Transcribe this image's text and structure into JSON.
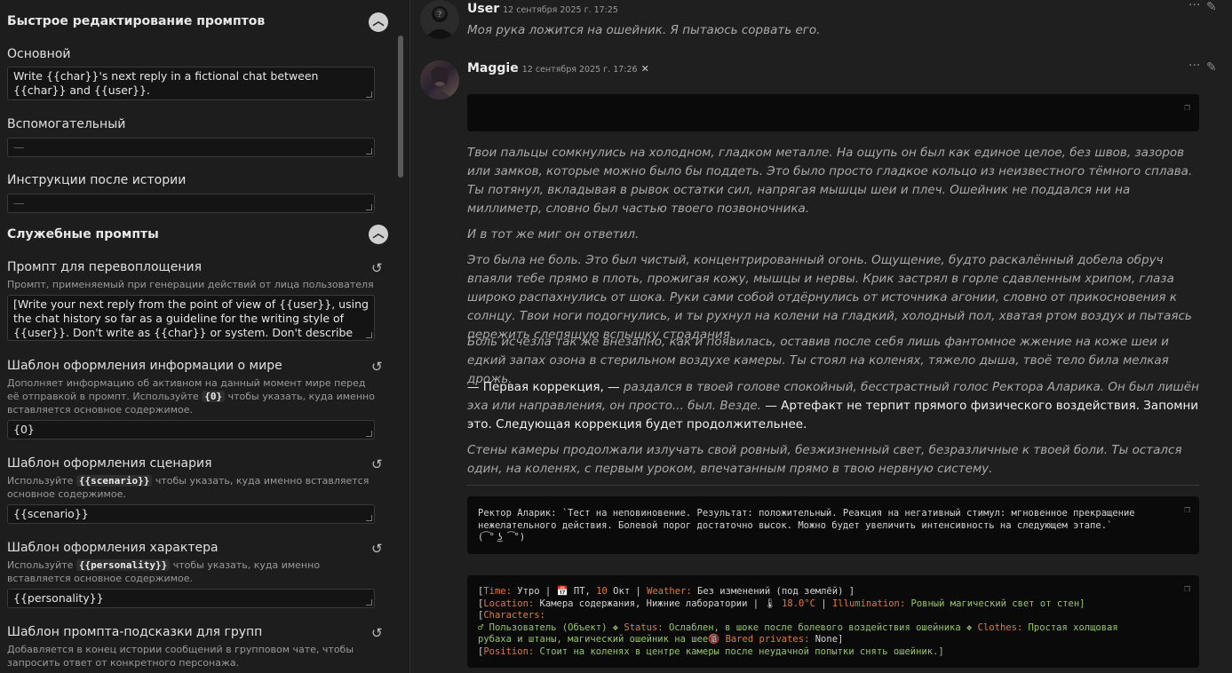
{
  "left_panel": {
    "quick_edit_title": "Быстрое редактирование промптов",
    "main_label": "Основной",
    "main_value": "Write {{char}}'s next reply in a fictional chat between {{char}} and {{user}}.",
    "aux_label": "Вспомогательный",
    "aux_value": "—",
    "post_label": "Инструкции после истории",
    "post_value": "—",
    "service_title": "Служебные промпты",
    "impersonation_label": "Промпт для перевоплощения",
    "impersonation_desc": "Промпт, применяемый при генерации действий от лица пользователя",
    "impersonation_value": "[Write your next reply from the point of view of {{user}}, using the chat history so far as a guideline for the writing style of {{user}}. Don't write as {{char}} or system. Don't describe actions of {{char}}.]",
    "world_label": "Шаблон оформления информации о мире",
    "world_desc_a": "Дополняет информацию об активном на данный момент мире перед её отправкой в промпт. Используйте",
    "world_code": "{0}",
    "world_desc_b": "чтобы указать, куда именно вставляется основное содержимое.",
    "world_value": "{0}",
    "scenario_label": "Шаблон оформления сценария",
    "scenario_desc_a": "Используйте",
    "scenario_code": "{{scenario}}",
    "scenario_desc_b": "чтобы указать, куда именно вставляется основное содержимое.",
    "scenario_value": "{{scenario}}",
    "char_label": "Шаблон оформления характера",
    "char_desc_a": "Используйте",
    "char_code": "{{personality}}",
    "char_desc_b": "чтобы указать, куда именно вставляется основное содержимое.",
    "char_value": "{{personality}}",
    "group_label": "Шаблон промпта-подсказки для групп",
    "group_desc": "Добавляется в конец истории сообщений в групповом чате, чтобы запросить ответ от конкретного персонажа.",
    "collapse_icon": "chevron-up-icon",
    "history_icon": "history-icon"
  },
  "chat": {
    "user_name": "User",
    "user_time": "12 сентября 2025 г. 17:25",
    "user_text": "Моя рука ложится на ошейник. Я пытаюсь сорвать его.",
    "bot_name": "Maggie",
    "bot_time": "12 сентября 2025 г. 17:26",
    "p1": "Твои пальцы сомкнулись на холодном, гладком металле. На ощупь он был как единое целое, без швов, зазоров или замков, которые можно было бы поддеть. Это было просто гладкое кольцо из неизвестного тёмного сплава. Ты потянул, вкладывая в рывок остатки сил, напрягая мышцы шеи и плеч. Ошейник не поддался ни на миллиметр, словно был частью твоего позвоночника.",
    "p2": "И в тот же миг он ответил.",
    "p3": "Это была не боль. Это был чистый, концентрированный огонь. Ощущение, будто раскалённый добела обруч впаяли тебе прямо в плоть, прожигая кожу, мышцы и нервы. Крик застрял в горле сдавленным хрипом, глаза широко распахнулись от шока. Руки сами собой отдёрнулись от источника агонии, словно от прикосновения к солнцу. Твои ноги подогнулись, и ты рухнул на колени на гладкий, холодный пол, хватая ртом воздух и пытаясь пережить слепящую вспышку страдания.",
    "p4": "Боль исчезла так же внезапно, как и появилась, оставив после себя лишь фантомное жжение на коже шеи и едкий запах озона в стерильном воздухе камеры. Ты стоял на коленях, тяжело дыша, твоё тело била мелкая дрожь.",
    "p5_strong_a": "— Первая коррекция, —",
    "p5_italic": " раздался в твоей голове спокойный, бесстрастный голос Ректора Аларика. Он был лишён эха или направления, он просто... был. Везде. ",
    "p5_strong_b": "— Артефакт не терпит прямого физического воздействия. Запомни это. Следующая коррекция будет продолжительнее.",
    "p6": "Стены камеры продолжали излучать свой ровный, безжизненный свет, безразличные к твоей боли. Ты остался один, на коленях, с первым уроком, впечатанным прямо в твою нервную систему.",
    "code1_line1": "Ректор Аларик: `Тест на неповиновение. Результат: положительный. Реакция на негативный стимул: мгновенное прекращение",
    "code1_line2": "нежелательного действия. Болевой порог достаточно высок. Можно будет увеличить интенсивность на следующем этапе.`",
    "code1_line3": "(͡° ͜ʖ ͡°)",
    "status": {
      "time_key": "Time:",
      "time_val": " Утро | 📅 ПТ, ",
      "day_num": "10",
      "month": " Окт | ",
      "weather_key": "Weather:",
      "weather_val": " Без изменений (под землёй) ]",
      "location_key": "Location:",
      "location_val": " Камера содержания, Нижние лаборатории | 🌡 ",
      "temp": "18.0°C",
      "sep": " | ",
      "illum_key": "Illumination:",
      "illum_val": " Ровный магический свет от стен]",
      "characters_key": "Characters:",
      "char_line_a": "♂ Пользователь (Объект) ❖ ",
      "status_key": "Status:",
      "status_val": " Ослаблен, в шоке после болевого воздействия ошейника ❖ ",
      "clothes_key": "Clothes:",
      "clothes_val": " Простая холщовая",
      "clothes_val2": "рубаха и штаны, магический ошейник на шее🔞 ",
      "bared_key": "Bared privates:",
      "bared_val": " None]",
      "position_key": "Position:",
      "position_val": " Стоит на коленях в центре камеры после неудачной попытки снять ошейник.]"
    }
  }
}
